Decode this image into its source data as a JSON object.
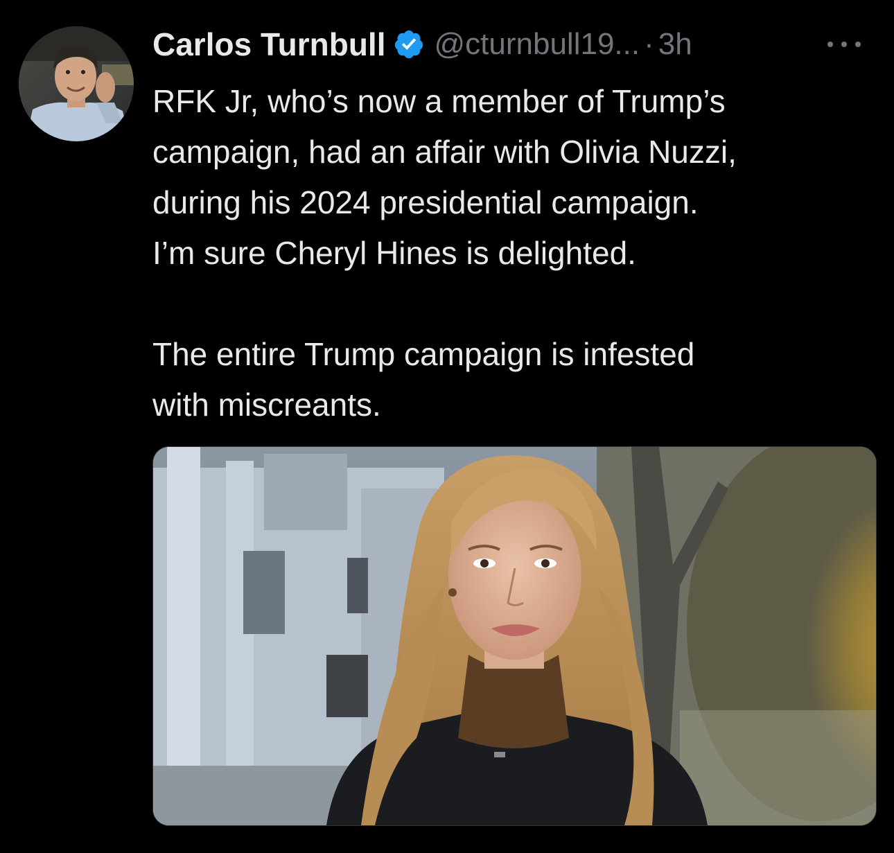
{
  "tweet": {
    "author": {
      "display_name": "Carlos Turnbull",
      "handle": "@cturnbull19...",
      "verified": true,
      "avatar_icon": "user-avatar-photo"
    },
    "separator": "·",
    "timestamp": "3h",
    "more_icon": "more-horizontal-icon",
    "text_paragraphs": [
      "RFK Jr, who’s now a member of Trump’s\ncampaign, had an affair with Olivia Nuzzi,\nduring his 2024 presidential campaign.\nI’m sure Cheryl Hines is delighted.",
      "The entire Trump campaign is infested\nwith miscreants."
    ],
    "media": {
      "type": "photo",
      "icon": "news-broadcast-photo"
    }
  },
  "colors": {
    "background": "#000000",
    "primary_text": "#e7e9ea",
    "secondary_text": "#71767b",
    "verified_blue": "#1d9bf0"
  }
}
